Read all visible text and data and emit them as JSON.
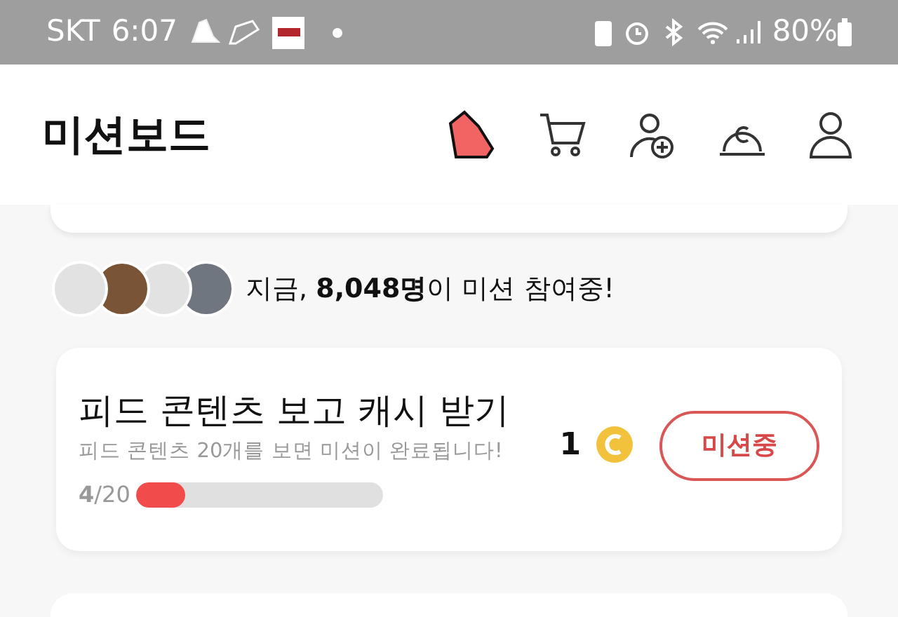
{
  "status_bar": {
    "carrier": "SKT",
    "time": "6:07",
    "battery": "80%"
  },
  "header": {
    "title": "미션보드"
  },
  "participants": {
    "text": "지금, **8,048명**이 미션 참여중!"
  },
  "mission": {
    "title": "피드 콘텐츠 보고 캐시 받기",
    "description": "피드 콘텐츠 20개를 보면 미션이 완료됩니다!",
    "reward": "1",
    "progress_text": "**4**/20",
    "level": 0.2,
    "button": "미션중"
  }
}
